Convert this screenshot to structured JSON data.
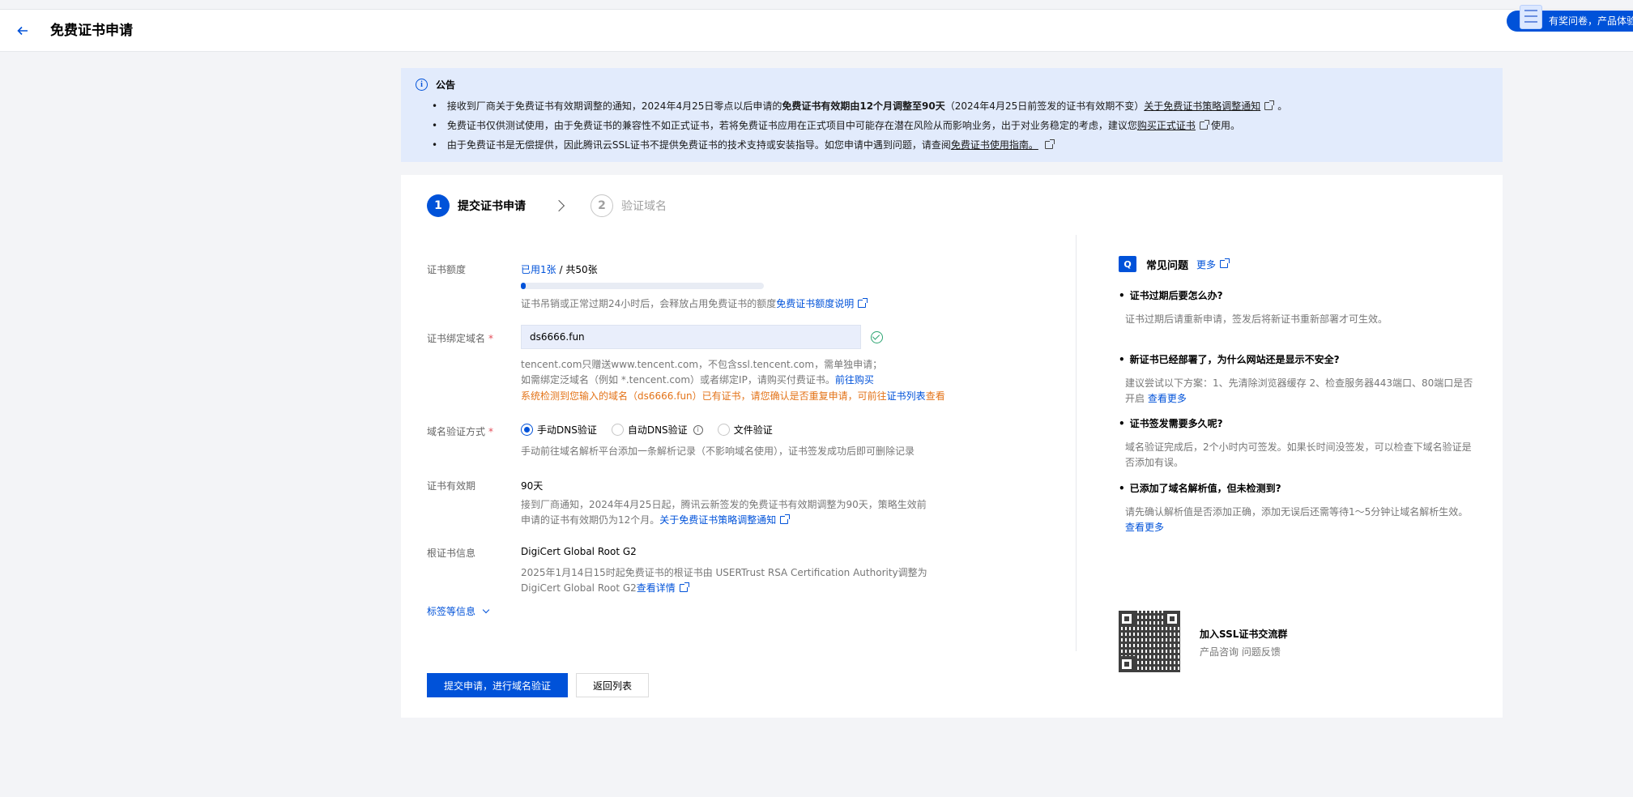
{
  "header": {
    "title": "免费证书申请",
    "survey_label": "有奖问卷，产品体验"
  },
  "notice": {
    "title": "公告",
    "items": [
      {
        "a": "接收到厂商关于免费证书有效期调整的通知，2024年4月25日零点以后申请的",
        "b": "免费证书有效期由12个月调整至90天",
        "c": "（2024年4月25日前签发的证书有效期不变）",
        "d": "关于免费证书策略调整通知",
        "e": "。"
      },
      {
        "a": "免费证书仅供测试使用，由于免费证书的兼容性不如正式证书，若将免费证书应用在正式项目中可能存在潜在风险从而影响业务，出于对业务稳定的考虑，建议您",
        "d": "购买正式证书",
        "e": "使用。"
      },
      {
        "a": "由于免费证书是无偿提供，因此腾讯云SSL证书不提供免费证书的技术支持或安装指导。如您申请中遇到问题，请查阅",
        "d": "免费证书使用指南。"
      }
    ]
  },
  "steps": [
    {
      "num": "1",
      "label": "提交证书申请"
    },
    {
      "num": "2",
      "label": "验证域名"
    }
  ],
  "form": {
    "quota": {
      "label": "证书额度",
      "used": "已用1张",
      "total": " / 共50张",
      "used_fraction": 0.02,
      "hint": "证书吊销或正常过期24小时后，会释放占用免费证书的额度",
      "hint_link": "免费证书额度说明"
    },
    "domain": {
      "label": "证书绑定域名",
      "required": "*",
      "value": "ds6666.fun",
      "hint1": "tencent.com只赠送www.tencent.com，不包含ssl.tencent.com，需单独申请；",
      "hint2": "如需绑定泛域名（例如 *.tencent.com）或者绑定IP，请购买付费证书。",
      "hint2_link": "前往购买",
      "warn": "系统检测到您输入的域名（ds6666.fun）已有证书，请您确认是否重复申请，可前往",
      "warn_link": "证书列表",
      "warn_tail": "查看"
    },
    "verify": {
      "label": "域名验证方式",
      "required": "*",
      "options": [
        "手动DNS验证",
        "自动DNS验证",
        "文件验证"
      ],
      "selected": "手动DNS验证",
      "hint": "手动前往域名解析平台添加一条解析记录（不影响域名使用），证书签发成功后即可删除记录"
    },
    "validity": {
      "label": "证书有效期",
      "value": "90天",
      "hint1": "接到厂商通知，2024年4月25日起，腾讯云新签发的免费证书有效期调整为90天，策略生效前",
      "hint2": "申请的证书有效期仍为12个月。",
      "hint2_link": "关于免费证书策略调整通知"
    },
    "root": {
      "label": "根证书信息",
      "value": "DigiCert Global Root G2",
      "hint1": "2025年1月14日15时起免费证书的根证书由 USERTrust RSA Certification Authority调整为",
      "hint2": "DigiCert Global Root G2",
      "hint2_link": "查看详情"
    },
    "tag_toggle": "标签等信息"
  },
  "faq": {
    "logo": "Q",
    "title": "常见问题",
    "more": "更多",
    "items": [
      {
        "q": "证书过期后要怎么办?",
        "a1": "证书过期后请重新申请，签发后将新证书重新部署才可生效。",
        "a2": "",
        "link": ""
      },
      {
        "q": "新证书已经部署了，为什么网站还是显示不安全?",
        "a1": "建议尝试以下方案：1、先清除浏览器缓存 2、检查服务器443端口、80端口是否",
        "a2": "开启 ",
        "link": "查看更多"
      },
      {
        "q": "证书签发需要多久呢?",
        "a1": "域名验证完成后，2个小时内可签发。如果长时间没签发，可以检查下域名验证是",
        "a2": "否添加有误。",
        "link": ""
      },
      {
        "q": "已添加了域名解析值，但未检测到?",
        "a1": "请先确认解析值是否添加正确，添加无误后还需等待1～5分钟让域名解析生效。",
        "a2": "",
        "link": "查看更多"
      }
    ],
    "group_title": "加入SSL证书交流群",
    "group_sub": "产品咨询 问题反馈"
  },
  "actions": {
    "submit": "提交申请，进行域名验证",
    "back": "返回列表"
  },
  "colors": {
    "primary": "#0052d9",
    "warning": "#e37318",
    "success": "#2ba471",
    "notice_bg": "#e2ebfc"
  }
}
